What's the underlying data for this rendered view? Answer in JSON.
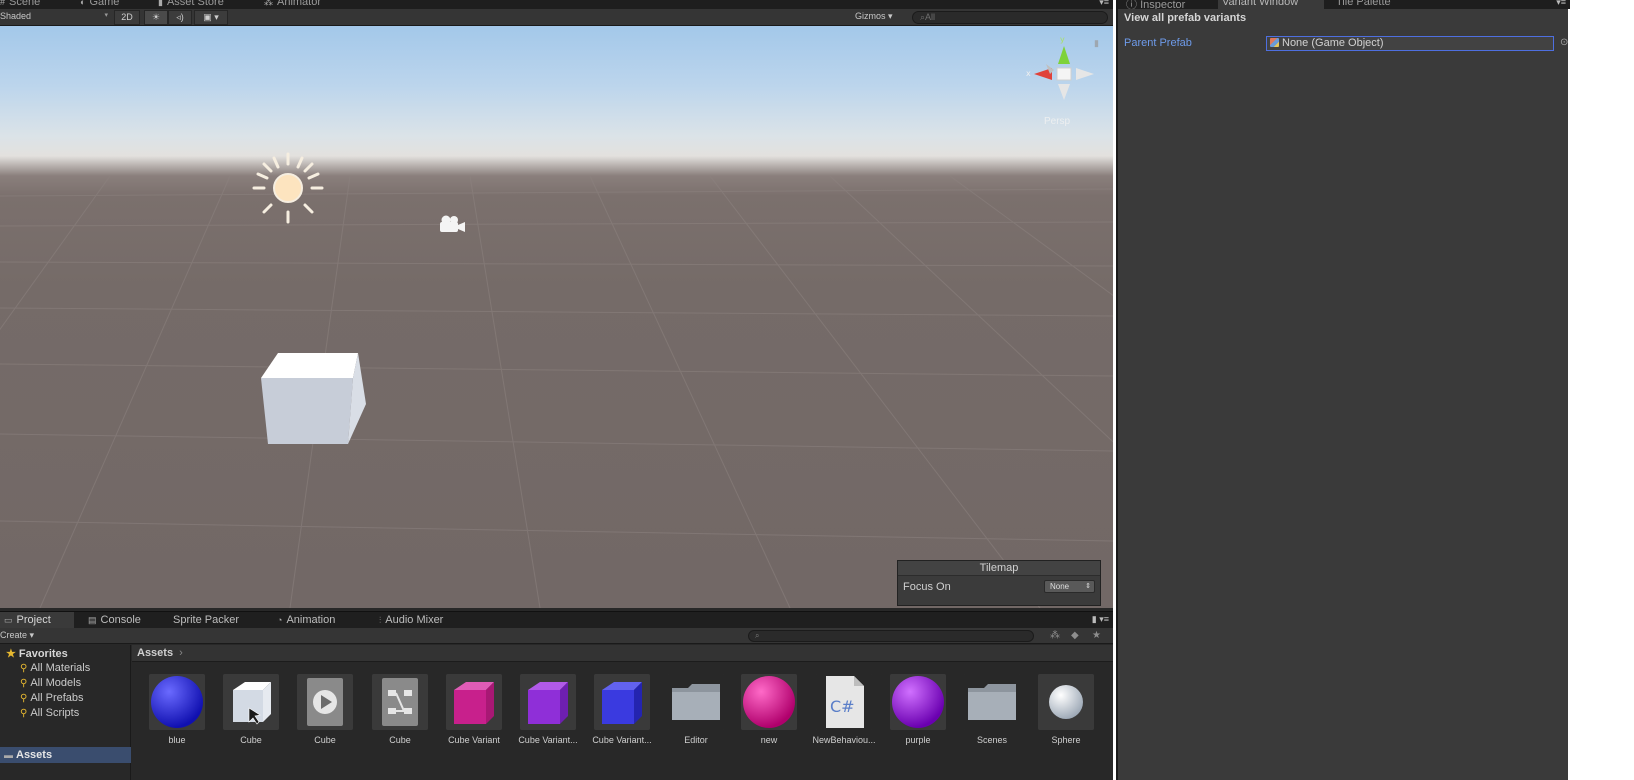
{
  "scene_window": {
    "tabs": [
      {
        "label": "Scene",
        "icon": "scene-icon"
      },
      {
        "label": "Game",
        "icon": "game-icon"
      },
      {
        "label": "Asset Store",
        "icon": "store-icon"
      },
      {
        "label": "Animator",
        "icon": "animator-icon"
      }
    ],
    "toolbar": {
      "shading_mode": "Shaded",
      "mode_2d": "2D",
      "gizmos_label": "Gizmos",
      "search_placeholder": "All"
    },
    "projection_label": "Persp"
  },
  "tilemap_overlay": {
    "title": "Tilemap",
    "focus_label": "Focus On",
    "focus_value": "None"
  },
  "project_window": {
    "tabs": [
      {
        "label": "Project",
        "icon": "folder-icon"
      },
      {
        "label": "Console",
        "icon": "console-icon"
      },
      {
        "label": "Sprite Packer",
        "icon": ""
      },
      {
        "label": "Animation",
        "icon": "animation-icon"
      },
      {
        "label": "Audio Mixer",
        "icon": "mixer-icon"
      }
    ],
    "create_label": "Create",
    "favorites": {
      "header": "Favorites",
      "items": [
        "All Materials",
        "All Models",
        "All Prefabs",
        "All Scripts"
      ]
    },
    "root_folder": "Assets",
    "breadcrumb": "Assets",
    "assets": [
      {
        "label": "blue",
        "kind": "material",
        "color": "#2a2ae6"
      },
      {
        "label": "Cube",
        "kind": "prefab",
        "color": "#d8dee6"
      },
      {
        "label": "Cube",
        "kind": "animation",
        "color": "#8c8c8c"
      },
      {
        "label": "Cube",
        "kind": "animator-controller",
        "color": "#8c8c8c"
      },
      {
        "label": "Cube Variant",
        "kind": "prefab-variant",
        "color": "#d0309a"
      },
      {
        "label": "Cube Variant...",
        "kind": "prefab-variant",
        "color": "#8f2fd8"
      },
      {
        "label": "Cube Variant...",
        "kind": "prefab-variant",
        "color": "#3a3ae0"
      },
      {
        "label": "Editor",
        "kind": "folder",
        "color": "#9aa2ab"
      },
      {
        "label": "new",
        "kind": "material",
        "color": "#e0108c"
      },
      {
        "label": "NewBehaviou...",
        "kind": "script",
        "color": "#dcdcdc"
      },
      {
        "label": "purple",
        "kind": "material",
        "color": "#9a20e0"
      },
      {
        "label": "Scenes",
        "kind": "folder",
        "color": "#9aa2ab"
      },
      {
        "label": "Sphere",
        "kind": "mesh",
        "color": "#e8ecf0"
      }
    ]
  },
  "inspector": {
    "tabs": [
      {
        "label": "Inspector",
        "icon": "info-icon"
      },
      {
        "label": "Variant Window",
        "icon": ""
      },
      {
        "label": "Tile Palette",
        "icon": ""
      }
    ],
    "heading": "View all prefab variants",
    "parent_prefab_label": "Parent Prefab",
    "parent_prefab_value": "None (Game Object)"
  },
  "colors": {
    "selection_blue": "#3a4d6e",
    "link_blue": "#6e9bea",
    "favorites_gold": "#e6b830"
  }
}
